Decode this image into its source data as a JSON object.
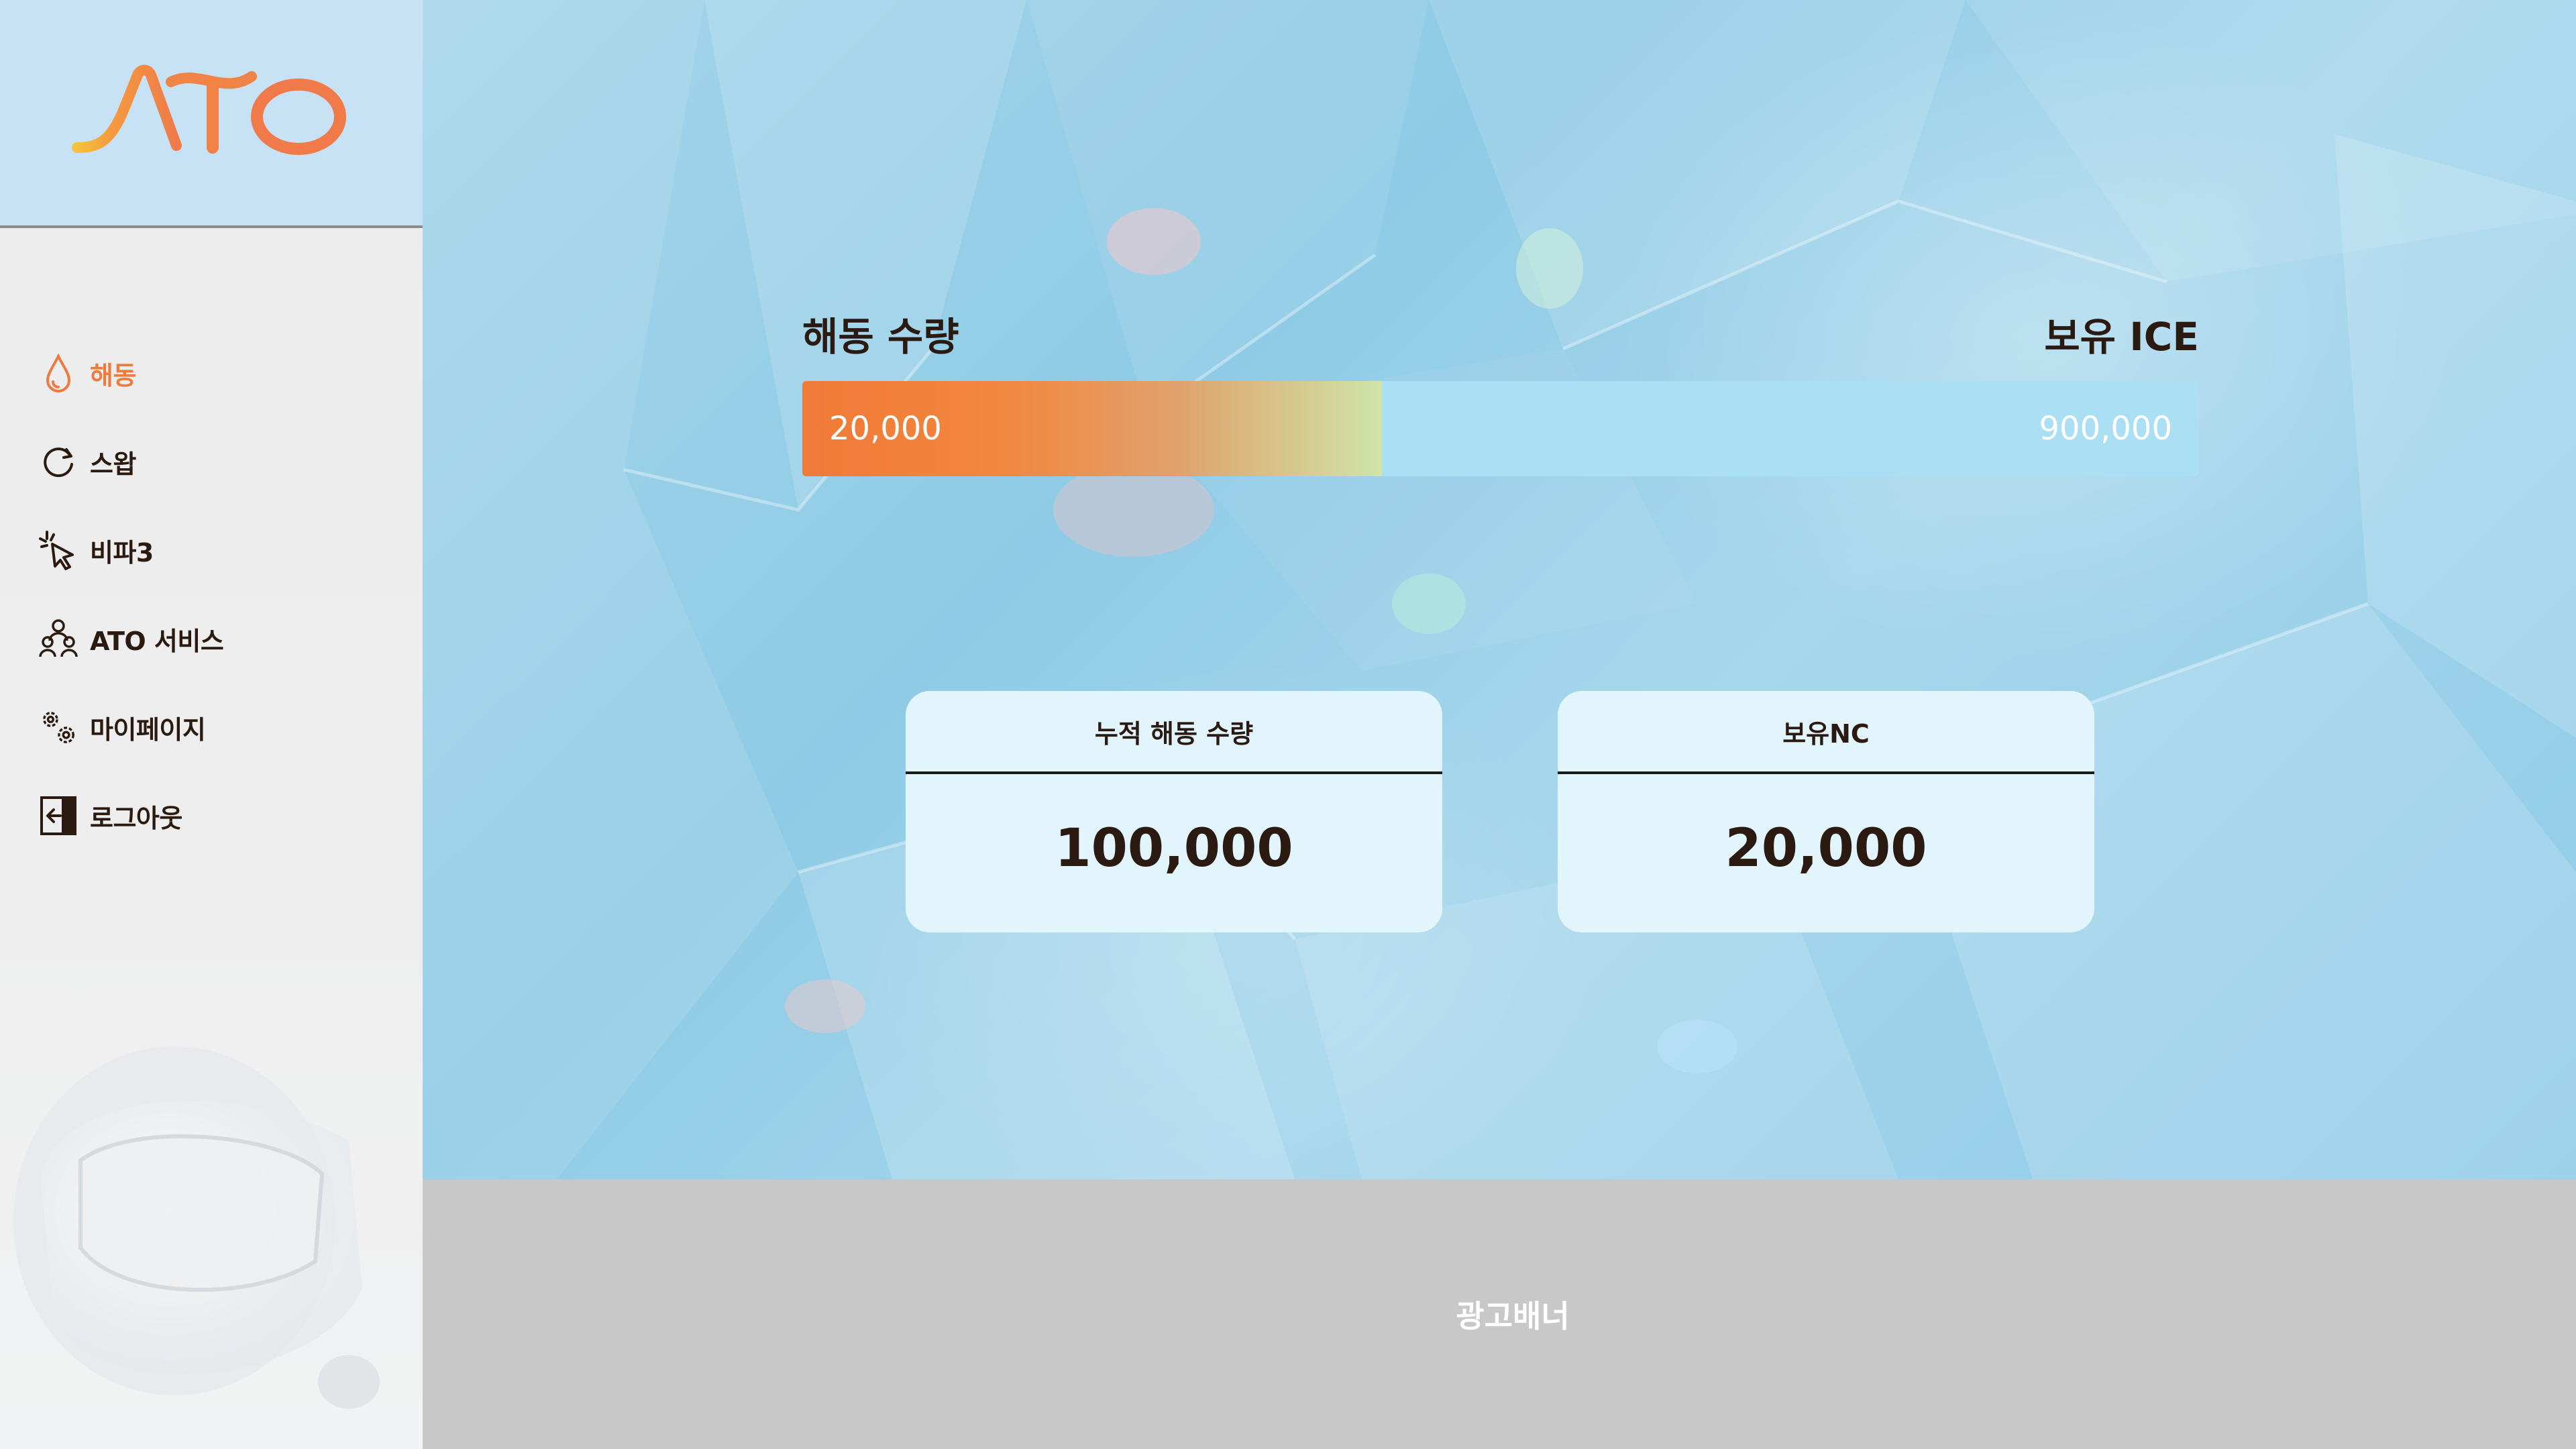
{
  "brand": {
    "logo_text": "ATO",
    "header_bg": "#c6e2f4",
    "accent": "#f07a3e"
  },
  "sidebar": {
    "items": [
      {
        "label": "해동",
        "icon": "droplet-icon",
        "active": true
      },
      {
        "label": "스왑",
        "icon": "refresh-icon",
        "active": false
      },
      {
        "label": "비파3",
        "icon": "cursor-click-icon",
        "active": false
      },
      {
        "label": "ATO 서비스",
        "icon": "users-group-icon",
        "active": false
      },
      {
        "label": "마이페이지",
        "icon": "gears-icon",
        "active": false
      },
      {
        "label": "로그아웃",
        "icon": "logout-icon",
        "active": false
      }
    ]
  },
  "main": {
    "thaw_label": "해동 수량",
    "ice_label": "보유 ICE",
    "progress": {
      "current": "20,000",
      "max": "900,000",
      "fill_fraction": 0.415
    },
    "cards": [
      {
        "title": "누적 해동 수량",
        "value": "100,000"
      },
      {
        "title": "보유NC",
        "value": "20,000"
      }
    ]
  },
  "ad_banner": {
    "label": "광고배너"
  }
}
